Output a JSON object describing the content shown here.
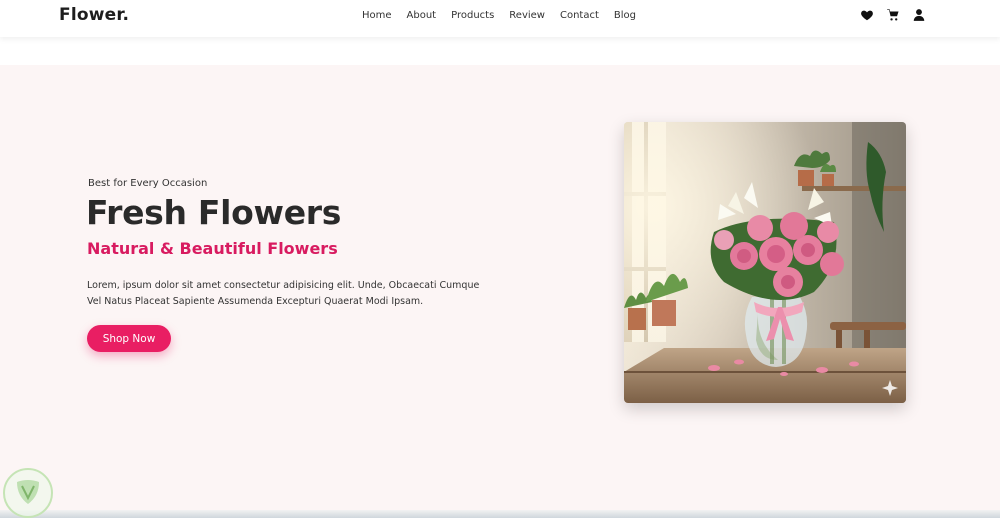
{
  "header": {
    "logo": "Flower.",
    "nav": [
      {
        "label": "Home"
      },
      {
        "label": "About"
      },
      {
        "label": "Products"
      },
      {
        "label": "Review"
      },
      {
        "label": "Contact"
      },
      {
        "label": "Blog"
      }
    ],
    "icons": [
      "heart-icon",
      "cart-icon",
      "user-icon"
    ]
  },
  "hero": {
    "eyebrow": "Best for Every Occasion",
    "title": "Fresh Flowers",
    "subtitle": "Natural & Beautiful Flowers",
    "description": "Lorem, ipsum dolor sit amet consectetur adipisicing elit. Unde, Obcaecati Cumque Vel Natus Placeat Sapiente Assumenda Excepturi Quaerat Modi Ipsam.",
    "button_label": "Shop Now",
    "image_alt": "flower-vase-image"
  },
  "colors": {
    "accent": "#e91e63",
    "subtitle": "#d81b60",
    "hero_bg": "#fcf5f5",
    "text_dark": "#2a2a2a"
  }
}
